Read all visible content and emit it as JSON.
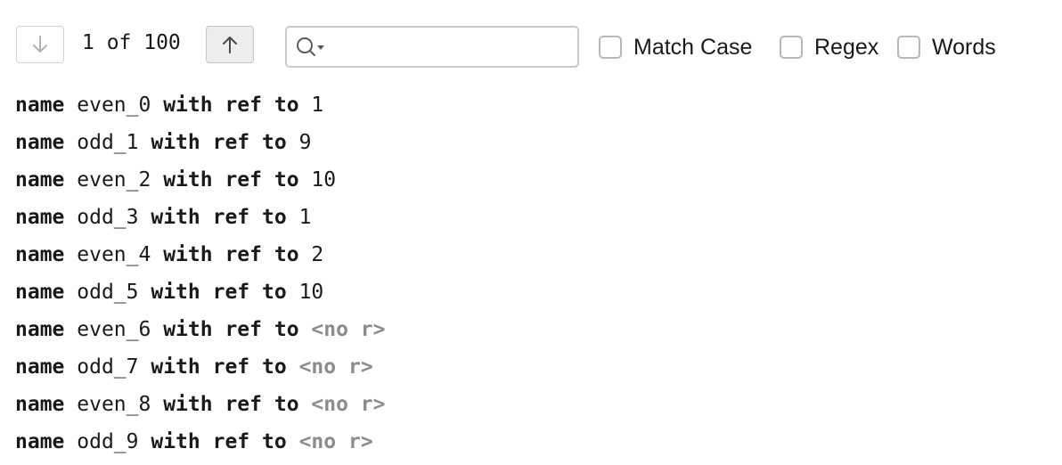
{
  "navigation": {
    "counter": "1 of 100",
    "prev_icon": "arrow-down-icon",
    "next_icon": "arrow-up-icon"
  },
  "search": {
    "icon": "search-icon",
    "value": "",
    "placeholder": ""
  },
  "options": [
    {
      "label": "Match Case",
      "checked": false
    },
    {
      "label": "Regex",
      "checked": false
    },
    {
      "label": "Words",
      "checked": false
    }
  ],
  "keywords": {
    "name": "name",
    "with": "with",
    "ref": "ref",
    "to": "to"
  },
  "results": [
    {
      "id": "even_0",
      "ref": "1",
      "has_ref": true
    },
    {
      "id": "odd_1",
      "ref": "9",
      "has_ref": true
    },
    {
      "id": "even_2",
      "ref": "10",
      "has_ref": true
    },
    {
      "id": "odd_3",
      "ref": "1",
      "has_ref": true
    },
    {
      "id": "even_4",
      "ref": "2",
      "has_ref": true
    },
    {
      "id": "odd_5",
      "ref": "10",
      "has_ref": true
    },
    {
      "id": "even_6",
      "ref": "<no r>",
      "has_ref": false
    },
    {
      "id": "odd_7",
      "ref": "<no r>",
      "has_ref": false
    },
    {
      "id": "even_8",
      "ref": "<no r>",
      "has_ref": false
    },
    {
      "id": "odd_9",
      "ref": "<no r>",
      "has_ref": false
    }
  ],
  "colors": {
    "text": "#1a1a1a",
    "muted": "#8c8c8c",
    "border": "#c9c9c9"
  }
}
